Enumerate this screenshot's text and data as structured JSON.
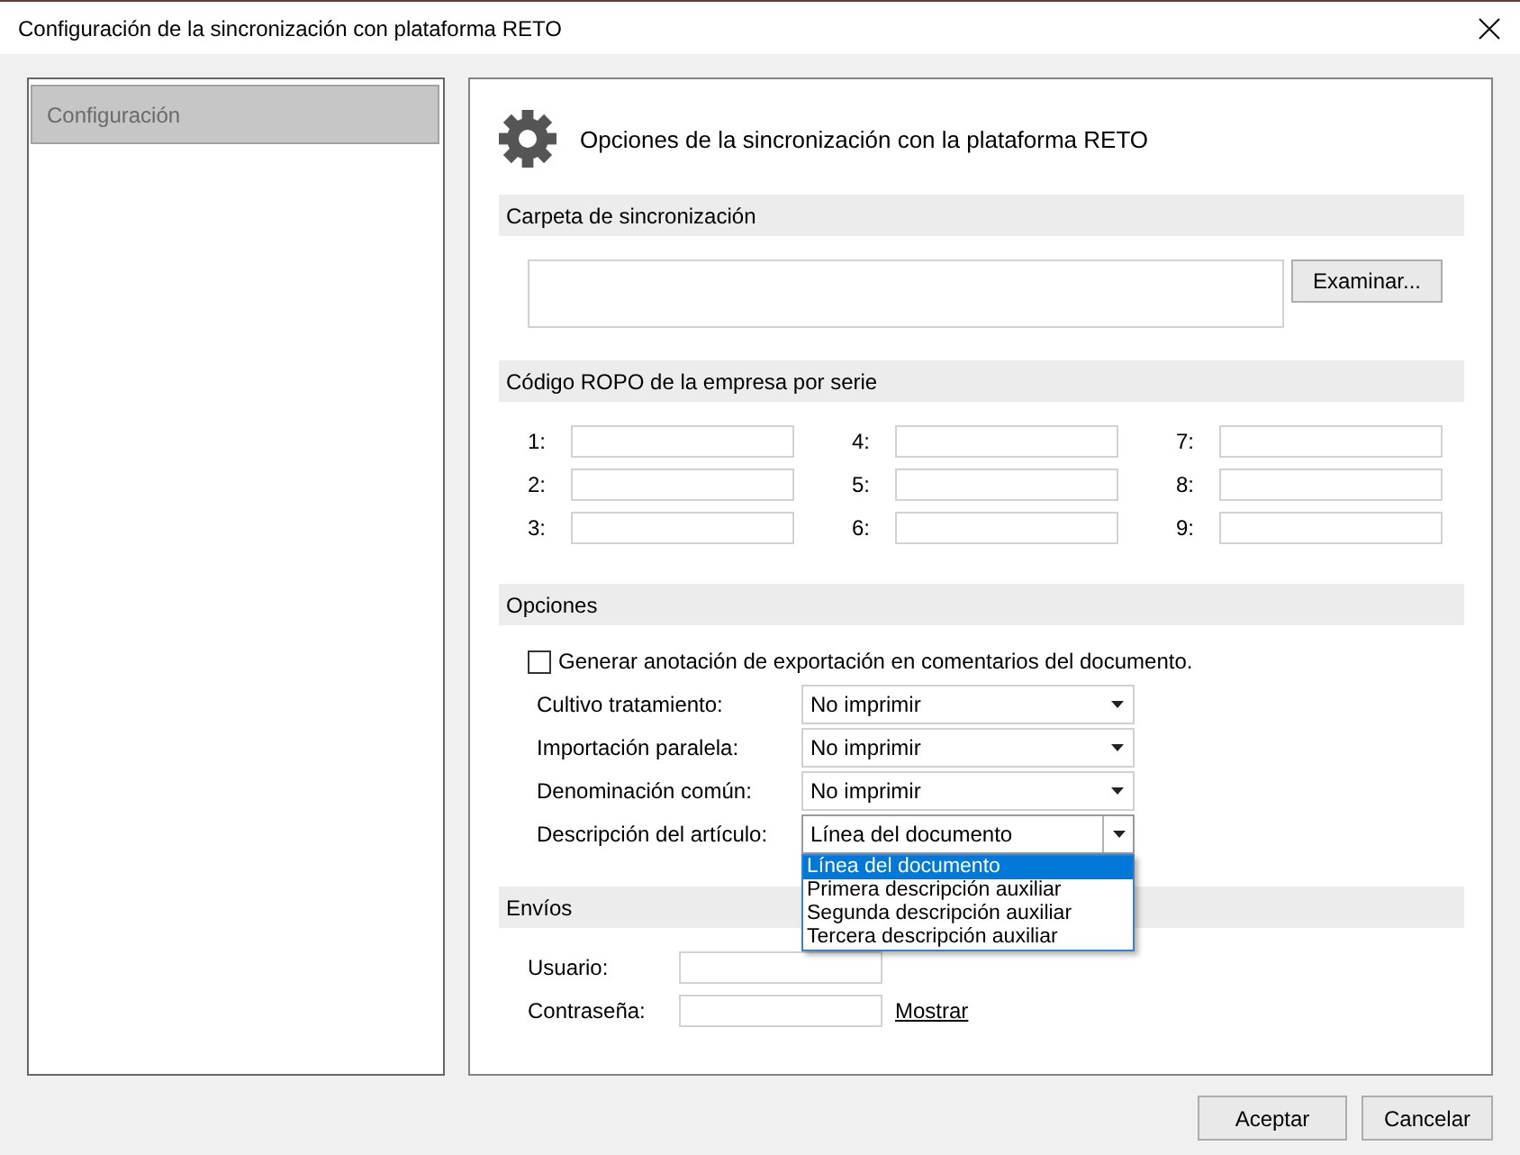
{
  "window": {
    "title": "Configuración de la sincronización con plataforma RETO"
  },
  "sidebar": {
    "items": [
      {
        "label": "Configuración",
        "selected": true
      }
    ]
  },
  "panel": {
    "heading": "Opciones de la sincronización con la plataforma RETO"
  },
  "folder_section": {
    "title": "Carpeta de sincronización",
    "browse_button": "Examinar..."
  },
  "ropo_section": {
    "title": "Código ROPO de la empresa por serie",
    "fields": [
      {
        "label": "1:"
      },
      {
        "label": "2:"
      },
      {
        "label": "3:"
      },
      {
        "label": "4:"
      },
      {
        "label": "5:"
      },
      {
        "label": "6:"
      },
      {
        "label": "7:"
      },
      {
        "label": "8:"
      },
      {
        "label": "9:"
      }
    ]
  },
  "options_section": {
    "title": "Opciones",
    "checkbox": {
      "label": "Generar anotación de exportación en comentarios del documento.",
      "checked": false
    },
    "selects": [
      {
        "label": "Cultivo tratamiento:",
        "value": "No imprimir",
        "open": false
      },
      {
        "label": "Importación paralela:",
        "value": "No imprimir",
        "open": false
      },
      {
        "label": "Denominación común:",
        "value": "No imprimir",
        "open": false
      },
      {
        "label": "Descripción del artículo:",
        "value": "Línea del documento",
        "open": true,
        "options": [
          {
            "label": "Línea del documento",
            "selected": true
          },
          {
            "label": "Primera descripción auxiliar",
            "selected": false
          },
          {
            "label": "Segunda descripción auxiliar",
            "selected": false
          },
          {
            "label": "Tercera descripción auxiliar",
            "selected": false
          }
        ]
      }
    ]
  },
  "shipping_section": {
    "title": "Envíos",
    "fields": [
      {
        "label": "Usuario:"
      },
      {
        "label": "Contraseña:",
        "link": "Mostrar"
      }
    ]
  },
  "buttons": [
    "Aceptar",
    "Cancelar"
  ]
}
